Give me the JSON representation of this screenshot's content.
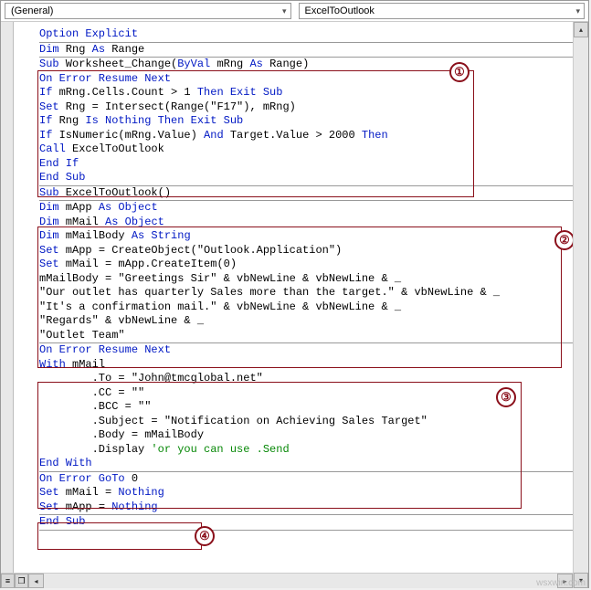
{
  "dropdowns": {
    "left": "(General)",
    "right": "ExcelToOutlook"
  },
  "code_tokens": [
    [
      {
        "t": "Option Explicit",
        "c": "kw"
      }
    ],
    "__div__",
    [
      {
        "t": "Dim",
        "c": "kw"
      },
      {
        "t": " Rng "
      },
      {
        "t": "As",
        "c": "kw"
      },
      {
        "t": " Range"
      }
    ],
    "__div__",
    [
      {
        "t": "Sub",
        "c": "kw"
      },
      {
        "t": " Worksheet_Change("
      },
      {
        "t": "ByVal",
        "c": "kw"
      },
      {
        "t": " mRng "
      },
      {
        "t": "As",
        "c": "kw"
      },
      {
        "t": " Range)"
      }
    ],
    [
      {
        "t": "On Error Resume Next",
        "c": "kw"
      }
    ],
    [
      {
        "t": "If",
        "c": "kw"
      },
      {
        "t": " mRng.Cells.Count > 1 "
      },
      {
        "t": "Then Exit Sub",
        "c": "kw"
      }
    ],
    [
      {
        "t": "Set",
        "c": "kw"
      },
      {
        "t": " Rng = Intersect(Range(\"F17\"), mRng)"
      }
    ],
    [
      {
        "t": "If",
        "c": "kw"
      },
      {
        "t": " Rng "
      },
      {
        "t": "Is Nothing Then Exit Sub",
        "c": "kw"
      }
    ],
    [
      {
        "t": "If",
        "c": "kw"
      },
      {
        "t": " IsNumeric(mRng.Value) "
      },
      {
        "t": "And",
        "c": "kw"
      },
      {
        "t": " Target.Value > 2000 "
      },
      {
        "t": "Then",
        "c": "kw"
      }
    ],
    [
      {
        "t": "Call",
        "c": "kw"
      },
      {
        "t": " ExcelToOutlook"
      }
    ],
    [
      {
        "t": "End If",
        "c": "kw"
      }
    ],
    [
      {
        "t": "End Sub",
        "c": "kw"
      }
    ],
    "__div__",
    [
      {
        "t": "Sub",
        "c": "kw"
      },
      {
        "t": " ExcelToOutlook()"
      }
    ],
    "__div__",
    [
      {
        "t": "Dim",
        "c": "kw"
      },
      {
        "t": " mApp "
      },
      {
        "t": "As Object",
        "c": "kw"
      }
    ],
    [
      {
        "t": "Dim",
        "c": "kw"
      },
      {
        "t": " mMail "
      },
      {
        "t": "As Object",
        "c": "kw"
      }
    ],
    [
      {
        "t": "Dim",
        "c": "kw"
      },
      {
        "t": " mMailBody "
      },
      {
        "t": "As String",
        "c": "kw"
      }
    ],
    [
      {
        "t": "Set",
        "c": "kw"
      },
      {
        "t": " mApp = CreateObject(\"Outlook.Application\")"
      }
    ],
    [
      {
        "t": "Set",
        "c": "kw"
      },
      {
        "t": " mMail = mApp.CreateItem(0)"
      }
    ],
    [
      {
        "t": "mMailBody = \"Greetings Sir\" & vbNewLine & vbNewLine & _"
      }
    ],
    [
      {
        "t": "\"Our outlet has quarterly Sales more than the target.\" & vbNewLine & _"
      }
    ],
    [
      {
        "t": "\"It's a confirmation mail.\" & vbNewLine & vbNewLine & _"
      }
    ],
    [
      {
        "t": "\"Regards\" & vbNewLine & _"
      }
    ],
    [
      {
        "t": "\"Outlet Team\""
      }
    ],
    "__div__",
    [
      {
        "t": "On Error Resume Next",
        "c": "kw"
      }
    ],
    [
      {
        "t": "With",
        "c": "kw"
      },
      {
        "t": " mMail"
      }
    ],
    [
      {
        "t": "        .To = \"John@tmcglobal.net\""
      }
    ],
    [
      {
        "t": "        .CC = \"\""
      }
    ],
    [
      {
        "t": "        .BCC = \"\""
      }
    ],
    [
      {
        "t": "        .Subject = \"Notification on Achieving Sales Target\""
      }
    ],
    [
      {
        "t": "        .Body = mMailBody"
      }
    ],
    [
      {
        "t": "        .Display "
      },
      {
        "t": "'or you can use .Send",
        "c": "cm"
      }
    ],
    [
      {
        "t": "End With",
        "c": "kw"
      }
    ],
    "__div__",
    [
      {
        "t": "On Error GoTo",
        "c": "kw"
      },
      {
        "t": " 0"
      }
    ],
    [
      {
        "t": "Set",
        "c": "kw"
      },
      {
        "t": " mMail = "
      },
      {
        "t": "Nothing",
        "c": "kw"
      }
    ],
    [
      {
        "t": "Set",
        "c": "kw"
      },
      {
        "t": " mApp = "
      },
      {
        "t": "Nothing",
        "c": "kw"
      }
    ],
    "__div__",
    [
      {
        "t": "End Sub",
        "c": "kw"
      }
    ],
    "__div__"
  ],
  "annotations": {
    "1": "①",
    "2": "②",
    "3": "③",
    "4": "④"
  },
  "watermark": "wsxwin.com"
}
